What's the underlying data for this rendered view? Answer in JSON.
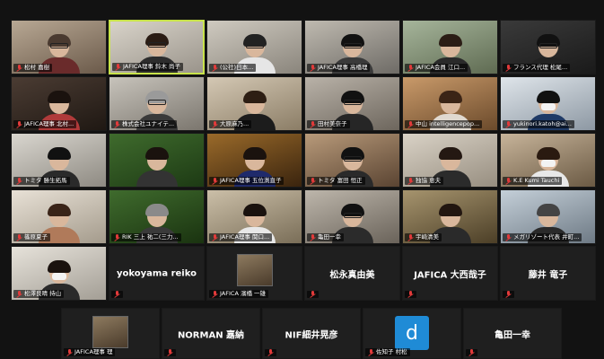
{
  "grid_tiles": [
    {
      "label": "松村 嘉樹",
      "mic": true,
      "kind": "video",
      "c1": "#b8a894",
      "c2": "#6b5a4a",
      "shirt": "#6a2b2b",
      "hair": "#4a3a30",
      "glasses": true
    },
    {
      "label": "JAFICA理事 鈴木 尚子",
      "mic": true,
      "kind": "video",
      "active": true,
      "c1": "#d8d3c9",
      "c2": "#9a948b",
      "shirt": "#2d2d2d",
      "hair": "#2a1c14",
      "glasses": true
    },
    {
      "label": "(公社)日本...",
      "mic": true,
      "kind": "video",
      "c1": "#cfcac0",
      "c2": "#8a857c",
      "shirt": "#e6e6e6",
      "hair": "#222",
      "glasses": true
    },
    {
      "label": "JAFICA理事 高橋理",
      "mic": true,
      "kind": "video",
      "c1": "#bfbab0",
      "c2": "#6e6b66",
      "shirt": "#3a3a3a",
      "hair": "#111",
      "glasses": true
    },
    {
      "label": "JAFICA会員 江口...",
      "mic": true,
      "kind": "video",
      "c1": "#a6b59b",
      "c2": "#5f6b52",
      "shirt": "#2a2a2a",
      "hair": "#2b1d15"
    },
    {
      "label": "フランス代理 松尾...",
      "mic": true,
      "kind": "video",
      "c1": "#3a3a3a",
      "c2": "#1a1a1a",
      "shirt": "#222",
      "hair": "#111",
      "glasses": true
    },
    {
      "label": "JAFICA理事 北村...",
      "mic": true,
      "kind": "video",
      "c1": "#4b3c33",
      "c2": "#1f1813",
      "shirt": "#b03a3a",
      "hair": "#1a120e"
    },
    {
      "label": "株式会社ユナイテ...",
      "mic": true,
      "kind": "video",
      "c1": "#c7c3bb",
      "c2": "#7b766e",
      "shirt": "#3a3a3a",
      "hair": "#9a9a9a",
      "glasses": true
    },
    {
      "label": "大原麻乃...",
      "mic": true,
      "kind": "video",
      "c1": "#d4c8b4",
      "c2": "#8b7d66",
      "shirt": "#1c1c1c",
      "hair": "#2d1e14"
    },
    {
      "label": "田村美奈子",
      "mic": true,
      "kind": "video",
      "c1": "#b9b2a8",
      "c2": "#6d665d",
      "shirt": "#262626",
      "hair": "#111",
      "glasses": true
    },
    {
      "label": "中山 intelligencepop...",
      "mic": true,
      "kind": "video",
      "c1": "#c99a6a",
      "c2": "#6b4a2b",
      "shirt": "#e0d9d0",
      "hair": "#3b2416"
    },
    {
      "label": "yukinori.katoh@ai...",
      "mic": true,
      "kind": "video",
      "c1": "#dfe5ea",
      "c2": "#8d98a3",
      "shirt": "#1f3a66",
      "hair": "#111",
      "mask": true
    },
    {
      "label": "トミタ 勝生拓馬",
      "mic": true,
      "kind": "video",
      "c1": "#d9d6cf",
      "c2": "#8e8a82",
      "shirt": "#2a2a2a",
      "hair": "#111"
    },
    {
      "label": "",
      "mic": false,
      "kind": "video",
      "c1": "#3f6b2d",
      "c2": "#1d3a14",
      "shirt": "#333",
      "hair": "#1a120e"
    },
    {
      "label": "JAFICA理事 五位渕直子",
      "mic": true,
      "kind": "video",
      "c1": "#9a6a2a",
      "c2": "#3a240e",
      "shirt": "#1f2a6b",
      "hair": "#1a120e"
    },
    {
      "label": "トミタ 富田 恒正",
      "mic": true,
      "kind": "video",
      "c1": "#b89a7a",
      "c2": "#5a4432",
      "shirt": "#2a2a2a",
      "hair": "#111",
      "glasses": true
    },
    {
      "label": "独協 恵夫",
      "mic": true,
      "kind": "video",
      "c1": "#d9d2c6",
      "c2": "#978e80",
      "shirt": "#2b2b2b",
      "hair": "#241812"
    },
    {
      "label": "K.E Kumi Tauchi",
      "mic": true,
      "kind": "video",
      "c1": "#c7b49a",
      "c2": "#6b5a44",
      "shirt": "#e8e8e8",
      "hair": "#2a1a10",
      "mask": true
    },
    {
      "label": "篠原夏子",
      "mic": true,
      "kind": "video",
      "c1": "#e8e1d6",
      "c2": "#a49b8c",
      "shirt": "#b07a5a",
      "hair": "#3a2418"
    },
    {
      "label": "RIK 三上 祐二(三力...",
      "mic": true,
      "kind": "video",
      "c1": "#3f6b2d",
      "c2": "#1a3310",
      "shirt": "#3a3a3a",
      "hair": "#8a8a8a"
    },
    {
      "label": "JAFICA理事 関口...",
      "mic": true,
      "kind": "video",
      "c1": "#cbbfa8",
      "c2": "#7a6e58",
      "shirt": "#e8e8e8",
      "hair": "#1a120e"
    },
    {
      "label": "亀田一幸",
      "mic": true,
      "kind": "video",
      "c1": "#bdb6ab",
      "c2": "#6a635a",
      "shirt": "#2b2b2b",
      "hair": "#111",
      "glasses": true
    },
    {
      "label": "宇崎清美",
      "mic": true,
      "kind": "video",
      "c1": "#a6946e",
      "c2": "#4c3f27",
      "shirt": "#2a2a2a",
      "hair": "#221610"
    },
    {
      "label": "メガリゾート代表 井町...",
      "mic": true,
      "kind": "video",
      "c1": "#c4cfd8",
      "c2": "#6e7a85",
      "shirt": "#2a2a2a",
      "hair": "#444"
    },
    {
      "label": "松澤良晴 持山",
      "mic": true,
      "kind": "video",
      "c1": "#e6e2da",
      "c2": "#a39e95",
      "shirt": "#2a2a2a",
      "hair": "#1a120e",
      "mask": true
    },
    {
      "label": "",
      "mic": true,
      "kind": "name",
      "name": "yokoyama reiko"
    },
    {
      "label": "JAFICA 濱橋 一雄",
      "mic": true,
      "kind": "avatar"
    },
    {
      "label": "",
      "mic": true,
      "kind": "name",
      "name": "松永真由美"
    },
    {
      "label": "",
      "mic": true,
      "kind": "name",
      "name": "JAFICA 大西哉子"
    },
    {
      "label": "",
      "mic": true,
      "kind": "name",
      "name": "藤井 竜子"
    }
  ],
  "bottom_tiles": [
    {
      "label": "JAFICA理事 理",
      "mic": true,
      "kind": "avatar"
    },
    {
      "label": "",
      "mic": true,
      "kind": "name",
      "name": "NORMAN 嘉納"
    },
    {
      "label": "",
      "mic": true,
      "kind": "name",
      "name": "NIF細井晃彦"
    },
    {
      "label": "佐知子 村松",
      "mic": true,
      "kind": "letter",
      "letter": "d"
    },
    {
      "label": "",
      "mic": true,
      "kind": "name",
      "name": "亀田一幸"
    }
  ]
}
